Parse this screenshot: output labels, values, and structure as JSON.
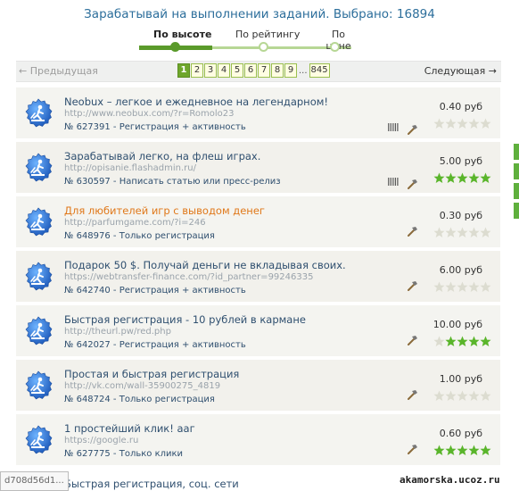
{
  "header": {
    "title": "Зарабатывай на выполнении заданий. Выбрано: 16894"
  },
  "sort": {
    "items": [
      "По высоте",
      "По рейтингу",
      "По цене"
    ],
    "active": 0
  },
  "pager": {
    "prev": "← Предыдущая",
    "next": "Следующая →",
    "pages": [
      "1",
      "2",
      "3",
      "4",
      "5",
      "6",
      "7",
      "8",
      "9"
    ],
    "ellipsis": "...",
    "last": "845",
    "current": "1"
  },
  "tasks": [
    {
      "title": "Neobux – легкое и ежедневное на легендарном!",
      "url": "http://www.neobux.com/?r=Romolo23",
      "meta": "№ 627391 - Регистрация + активность",
      "price": "0.40 руб",
      "rating": 0,
      "marks": true,
      "orange": false
    },
    {
      "title": "Зарабатывай легко, на флеш играх.",
      "url": "http://opisanie.flashadmin.ru/",
      "meta": "№ 630597 - Написать статью или пресс-релиз",
      "price": "5.00 руб",
      "rating": 5,
      "marks": true,
      "orange": false
    },
    {
      "title": "Для любителей игр с выводом денег",
      "url": "http://parfumgame.com/?i=246",
      "meta": "№ 648976 - Только регистрация",
      "price": "0.30 руб",
      "rating": 0,
      "marks": false,
      "orange": true
    },
    {
      "title": "Подарок 50 $. Получай деньги не вкладывая своих.",
      "url": "https://webtransfer-finance.com/?id_partner=99246335",
      "meta": "№ 642740 - Регистрация + активность",
      "price": "6.00 руб",
      "rating": 0,
      "marks": false,
      "orange": false
    },
    {
      "title": "Быстрая регистрация - 10 рублей в кармане",
      "url": "http://theurl.pw/red.php",
      "meta": "№ 642027 - Регистрация + активность",
      "price": "10.00 руб",
      "rating": 4,
      "marks": false,
      "orange": false
    },
    {
      "title": "Простая и быстрая регистрация",
      "url": "http://vk.com/wall-35900275_4819",
      "meta": "№ 648724 - Только регистрация",
      "price": "1.00 руб",
      "rating": 0,
      "marks": false,
      "orange": false
    },
    {
      "title": "1 простейший клик! ааг",
      "url": "https://google.ru",
      "meta": "№ 627775 - Только клики",
      "price": "0.60 руб",
      "rating": 5,
      "marks": false,
      "orange": false
    }
  ],
  "partial_task": {
    "title": "Быстрая регистрация, соц. сети"
  },
  "marks_text": "IIIII",
  "footer": {
    "hash": "d708d56d1...",
    "site": "akamorska.ucoz.ru"
  },
  "icons": {
    "badge": "worker-badge-icon",
    "hammer": "hammer-icon",
    "star": "star-icon"
  },
  "colors": {
    "accent_green": "#5a9a2a",
    "star_on": "#5ab52b",
    "star_off": "#dcdcd0",
    "badge_blue": "#2a6fd0"
  }
}
